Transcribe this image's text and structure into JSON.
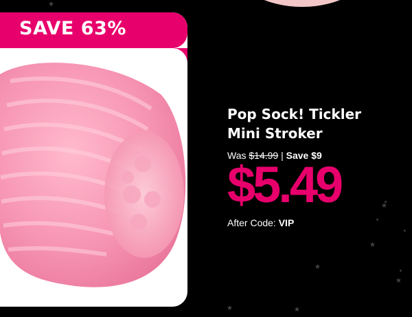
{
  "banner": {
    "save_label": "SAVE 63%"
  },
  "product": {
    "title_line1": "Pop Sock! Tickler",
    "title_line2": "Mini Stroker",
    "was_label": "Was",
    "was_price": "$14.99",
    "separator": "|",
    "save_amount": "Save $9",
    "sale_price": "$5.49",
    "code_label": "After Code:",
    "code_value": "VIP",
    "image_icon": "pink-stroker-product-image"
  },
  "colors": {
    "background": "#000000",
    "accent": "#e7006b",
    "card": "#ffffff",
    "product_pink": "#f47ea2"
  }
}
